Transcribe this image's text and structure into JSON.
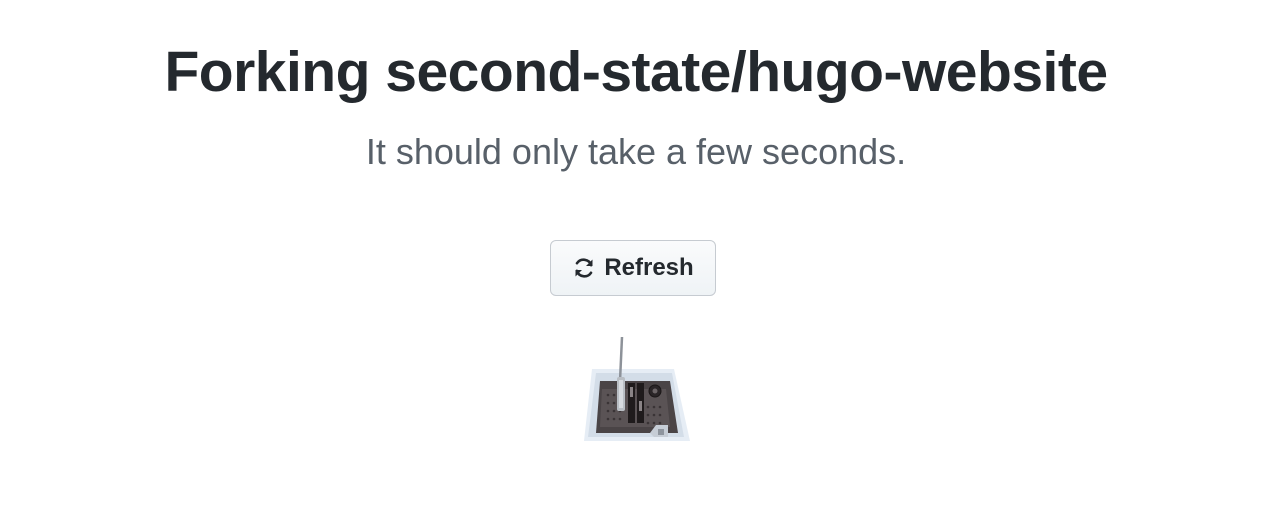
{
  "header": {
    "title": "Forking second-state/hugo-website",
    "subtitle": "It should only take a few seconds."
  },
  "actions": {
    "refresh_label": "Refresh",
    "refresh_icon": "sync-icon"
  },
  "illustration": {
    "icon": "photocopier-icon"
  }
}
